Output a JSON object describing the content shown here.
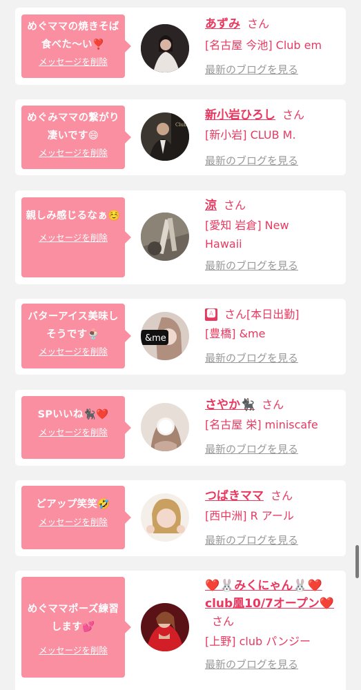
{
  "delete_label": "メッセージを削除",
  "san_label": "さん",
  "blog_label": "最新のブログを見る",
  "items": [
    {
      "message": "めぐママの焼きそば食べた〜い❣️",
      "name": "あずみ",
      "suffix": "",
      "store": "[名古屋 今池] Club em"
    },
    {
      "message": "めぐみママの繋がり凄いです😄",
      "name": "新小岩ひろし",
      "suffix": "",
      "store": "[新小岩] CLUB M."
    },
    {
      "message": "親しみ感じるなぁ☺️",
      "name": "涼",
      "suffix": "",
      "store": "[愛知 岩倉] New Hawaii"
    },
    {
      "message": "バターアイス美味しそうです🍨",
      "name": "🅰",
      "suffix": "[本日出勤]",
      "store": "[豊橋] &me"
    },
    {
      "message": "SPいいね🐈‍⬛❤️",
      "name": "さやか🐈‍⬛",
      "suffix": "",
      "store": "[名古屋 栄] miniscafe"
    },
    {
      "message": "どアップ笑笑🤣",
      "name": "つばきママ",
      "suffix": "",
      "store": "[西中洲] R アール"
    },
    {
      "message": "めぐママポーズ練習します💕",
      "name": "❤️🐰みくにゃん🐰❤️club凰10/7オープン❤️",
      "suffix": "",
      "store": "[上野] club パンジー"
    }
  ]
}
